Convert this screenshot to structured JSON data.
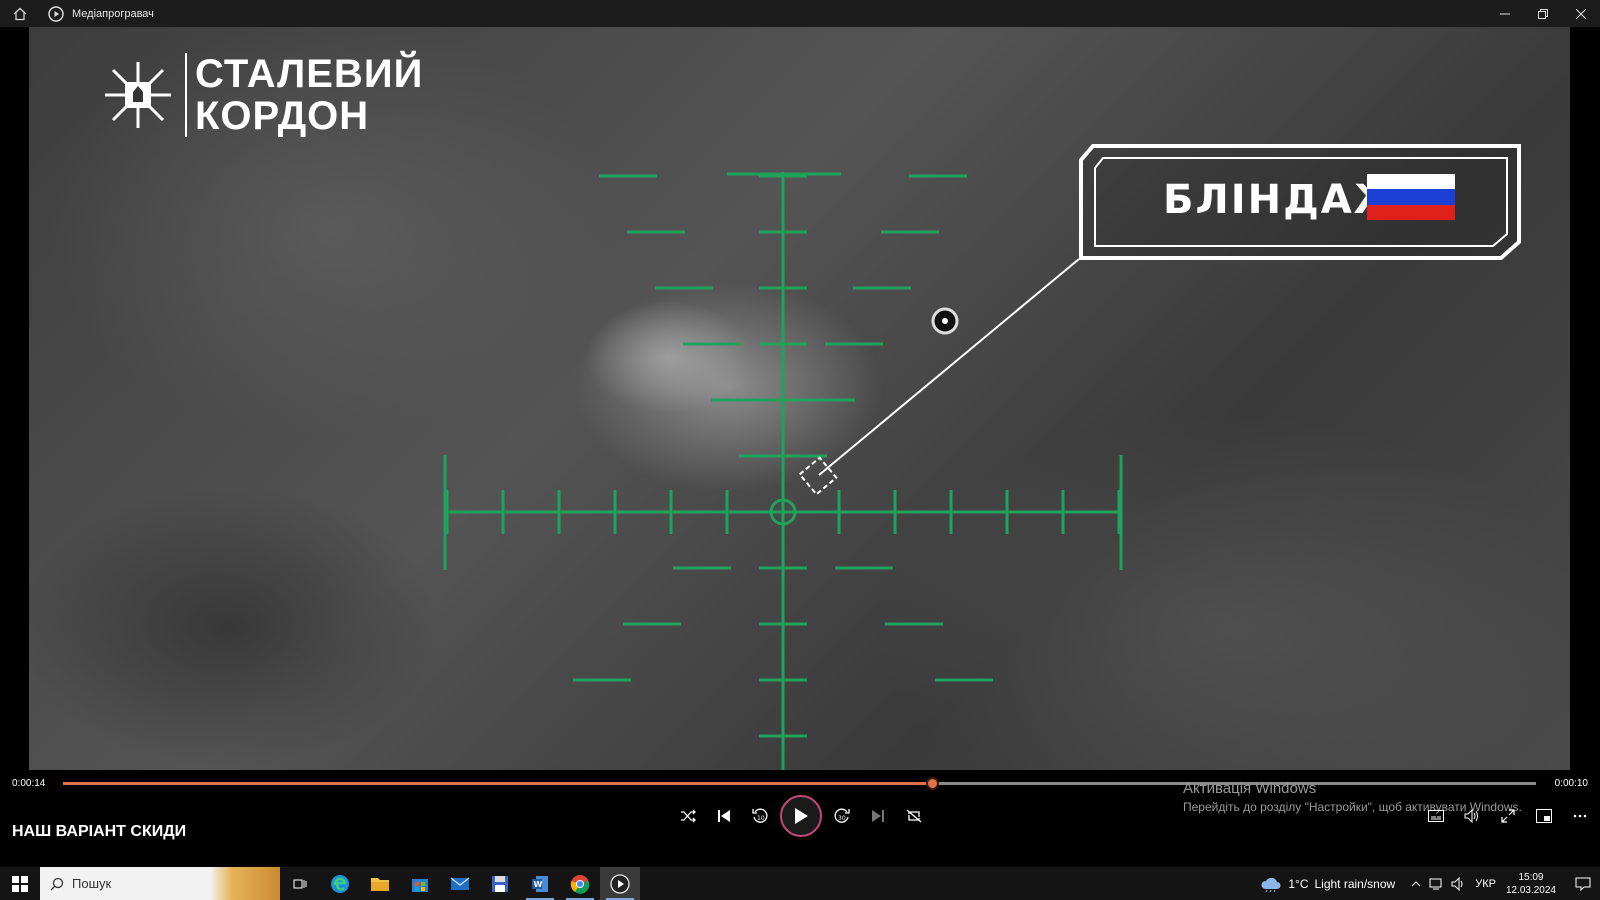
{
  "window": {
    "title": "Медіапрогравач"
  },
  "video": {
    "logo_line1": "СТАЛЕВИЙ",
    "logo_line2": "КОРДОН",
    "target_label": "БЛІНДАЖ",
    "flag_colors": [
      "#ffffff",
      "#1c3fd6",
      "#e0201a"
    ],
    "reticle_color": "#1fa35c"
  },
  "player": {
    "time_elapsed": "0:00:14",
    "time_total": "0:00:10",
    "progress_fraction": 0.59,
    "accent_color": "#e0714d",
    "now_playing": "НАШ ВАРІАНТ СКИДИ",
    "icons": [
      "shuffle-icon",
      "previous-icon",
      "rewind-10-icon",
      "play-icon",
      "forward-30-icon",
      "next-icon",
      "repeat-off-icon",
      "subtitles-icon",
      "volume-icon",
      "fullscreen-icon",
      "miniplayer-icon",
      "more-icon"
    ]
  },
  "watermark": {
    "line1": "Активація Windows",
    "line2": "Перейдіть до розділу \"Настройки\", щоб активувати Windows."
  },
  "taskbar": {
    "search_placeholder": "Пошук",
    "weather_temp": "1°C",
    "weather_desc": "Light rain/snow",
    "language": "УКР",
    "time": "15:09",
    "date": "12.03.2024"
  }
}
